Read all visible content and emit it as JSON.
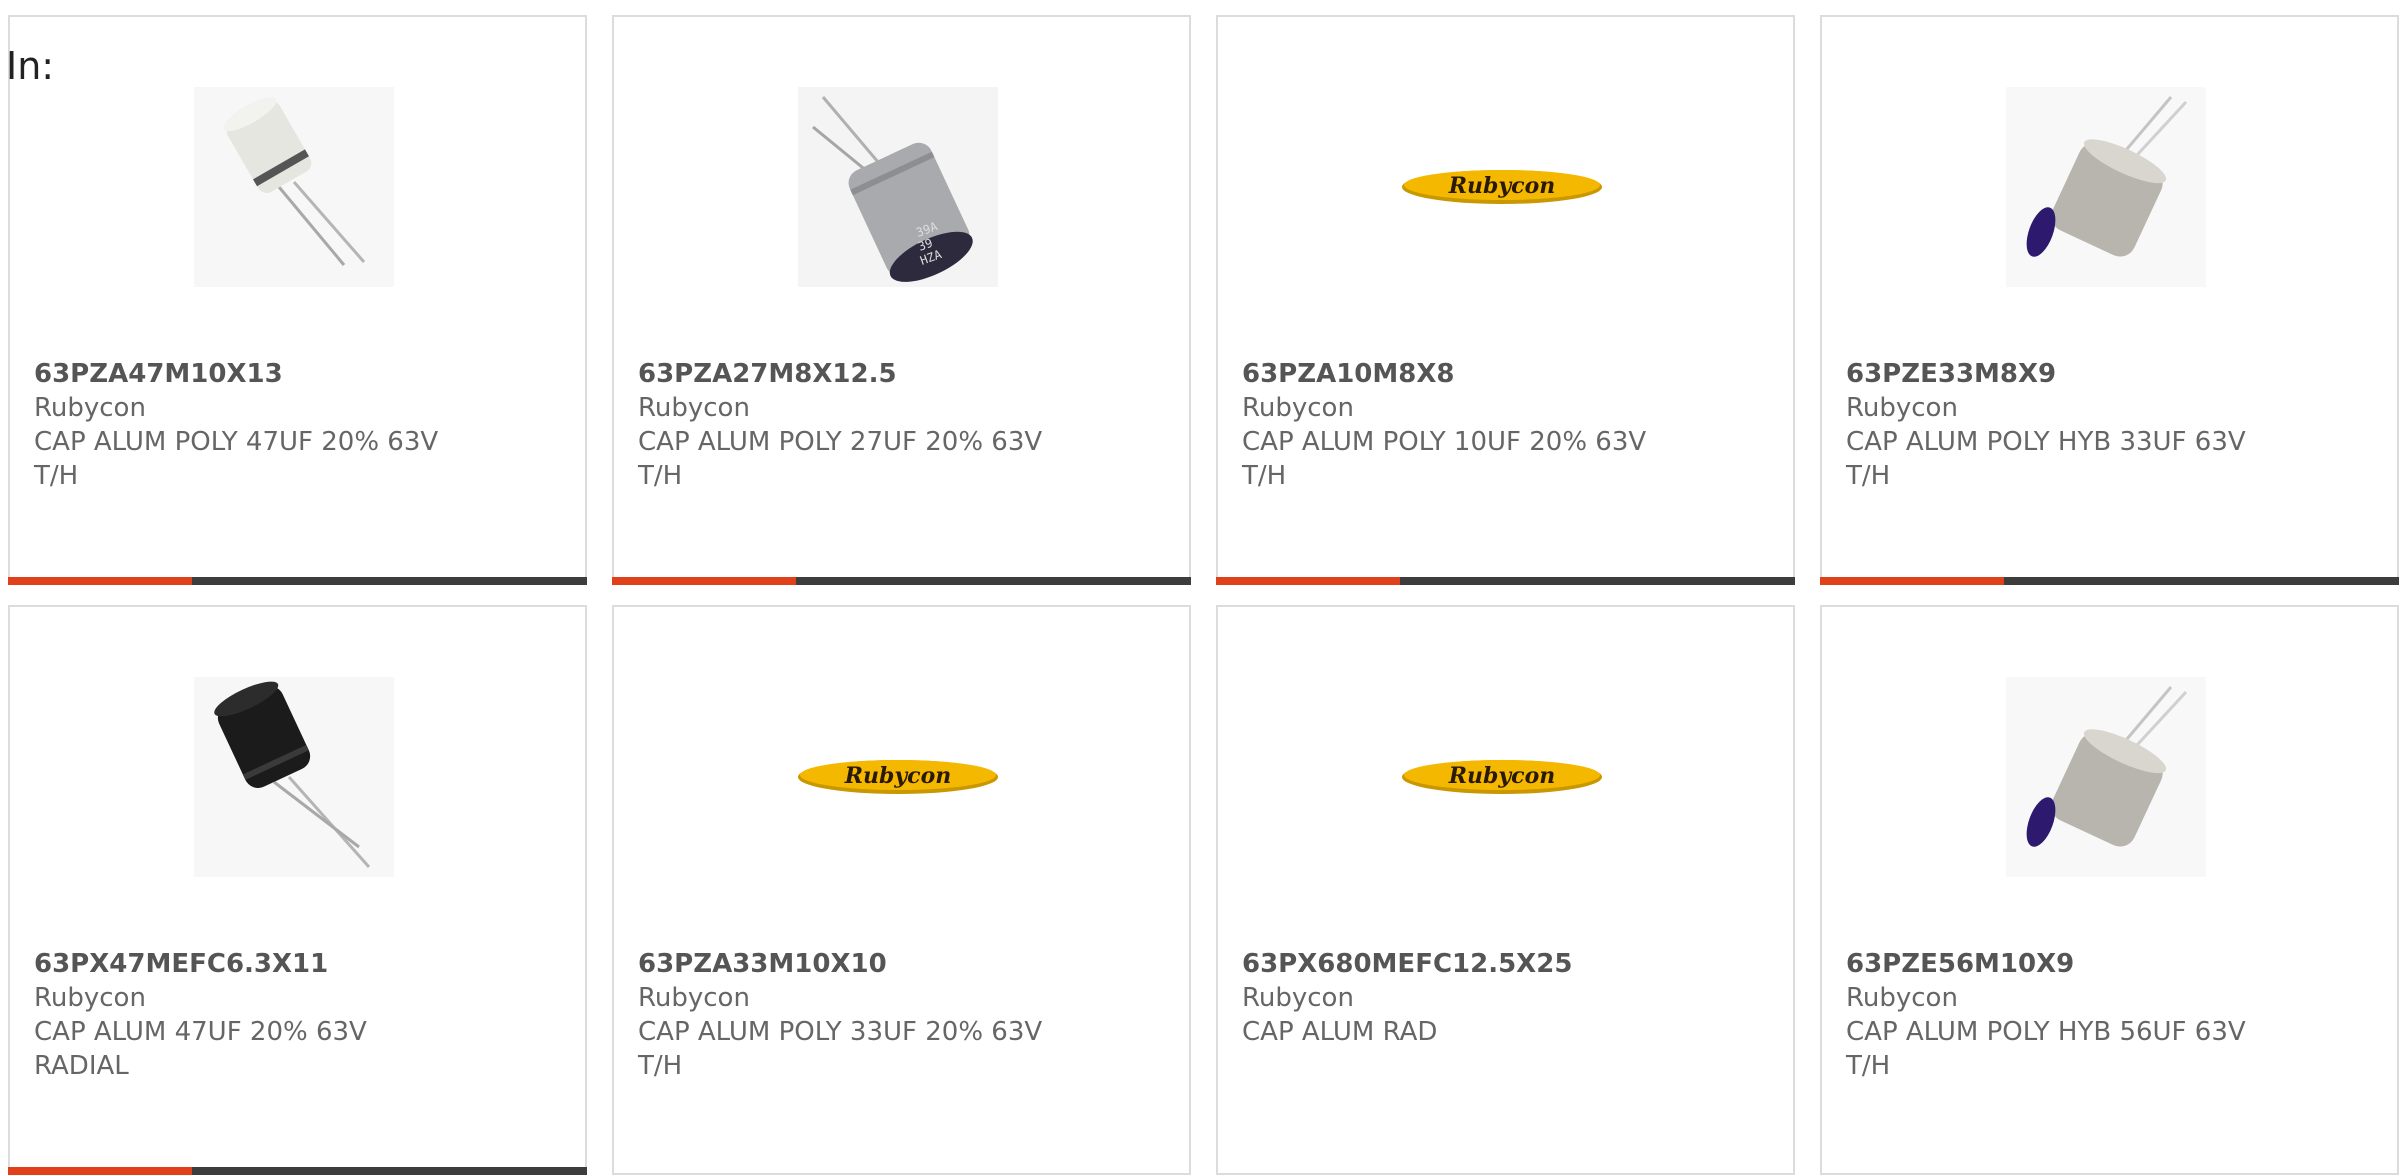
{
  "header": {
    "label": "In:"
  },
  "colors": {
    "accent": "#e0401a",
    "bar": "#3d3d3d",
    "text": "#666666",
    "border": "#dcdcdc",
    "logo_yellow": "#f5b800"
  },
  "products": [
    {
      "part_number": "63PZA47M10X13",
      "manufacturer": "Rubycon",
      "description": "CAP ALUM POLY 47UF 20% 63V",
      "description2": "T/H",
      "image": "capacitor-white-icon"
    },
    {
      "part_number": "63PZA27M8X12.5",
      "manufacturer": "Rubycon",
      "description": "CAP ALUM POLY 27UF 20% 63V",
      "description2": "T/H",
      "image": "capacitor-silver-icon",
      "marking": [
        "39A",
        "39",
        "HZA"
      ]
    },
    {
      "part_number": "63PZA10M8X8",
      "manufacturer": "Rubycon",
      "description": "CAP ALUM POLY 10UF 20% 63V",
      "description2": "T/H",
      "image": "rubycon-logo",
      "logo_text": "Rubycon"
    },
    {
      "part_number": "63PZE33M8X9",
      "manufacturer": "Rubycon",
      "description": "CAP ALUM POLY HYB 33UF 63V",
      "description2": "T/H",
      "image": "capacitor-purple-icon"
    },
    {
      "part_number": "63PX47MEFC6.3X11",
      "manufacturer": "Rubycon",
      "description": "CAP ALUM 47UF 20% 63V",
      "description2": "RADIAL",
      "image": "capacitor-black-icon"
    },
    {
      "part_number": "63PZA33M10X10",
      "manufacturer": "Rubycon",
      "description": "CAP ALUM POLY 33UF 20% 63V",
      "description2": "T/H",
      "image": "rubycon-logo",
      "logo_text": "Rubycon"
    },
    {
      "part_number": "63PX680MEFC12.5X25",
      "manufacturer": "Rubycon",
      "description": "CAP ALUM RAD",
      "description2": "",
      "image": "rubycon-logo",
      "logo_text": "Rubycon"
    },
    {
      "part_number": "63PZE56M10X9",
      "manufacturer": "Rubycon",
      "description": "CAP ALUM POLY HYB 56UF 63V",
      "description2": "T/H",
      "image": "capacitor-purple-icon"
    }
  ]
}
